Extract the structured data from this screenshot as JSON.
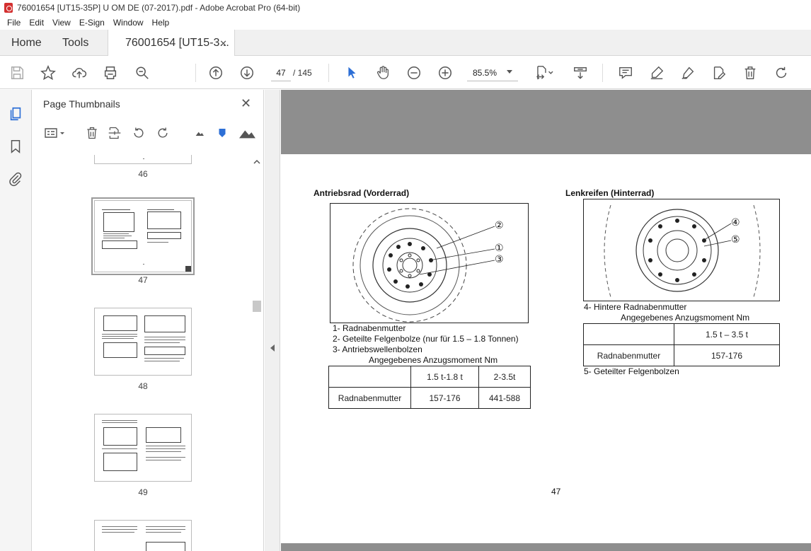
{
  "window": {
    "title": "76001654 [UT15-35P] U OM DE (07-2017).pdf - Adobe Acrobat Pro (64-bit)"
  },
  "menu": [
    "File",
    "Edit",
    "View",
    "E-Sign",
    "Window",
    "Help"
  ],
  "tabs": {
    "home": "Home",
    "tools": "Tools",
    "document": "76001654 [UT15-3...",
    "close_glyph": "✕"
  },
  "toolbar": {
    "current_page": "47",
    "page_total": "/ 145",
    "zoom": "85.5%"
  },
  "thumb_panel": {
    "title": "Page Thumbnails",
    "close_glyph": "✕",
    "pages": [
      {
        "label": "46"
      },
      {
        "label": "47",
        "selected": true
      },
      {
        "label": "48"
      },
      {
        "label": "49"
      }
    ]
  },
  "pdf": {
    "left": {
      "heading": "Antriebsrad (Vorderrad)",
      "callouts": [
        "②",
        "①",
        "③"
      ],
      "legend": [
        "1- Radnabenmutter",
        "2- Geteilte Felgenbolze (nur für 1.5 – 1.8 Tonnen)",
        "3- Antriebswellenbolzen"
      ],
      "torque_title": "Angegebenes Anzugsmoment Nm",
      "table": {
        "header": [
          "",
          "1.5 t-1.8 t",
          "2-3.5t"
        ],
        "row": [
          "Radnabenmutter",
          "157-176",
          "441-588"
        ]
      }
    },
    "right": {
      "heading": "Lenkreifen (Hinterrad)",
      "callouts": [
        "④",
        "⑤"
      ],
      "legend_top": "4- Hintere Radnabenmutter",
      "torque_title": "Angegebenes Anzugsmoment Nm",
      "table": {
        "header": [
          "",
          "1.5 t – 3.5 t"
        ],
        "row": [
          "Radnabenmutter",
          "157-176"
        ]
      },
      "legend_bottom": "5- Geteilter Felgenbolzen"
    },
    "page_number": "47"
  },
  "colors": {
    "accent": "#2d6fd6",
    "doc_background": "#8e8e8e",
    "acrobat_red": "#d32f2f"
  }
}
